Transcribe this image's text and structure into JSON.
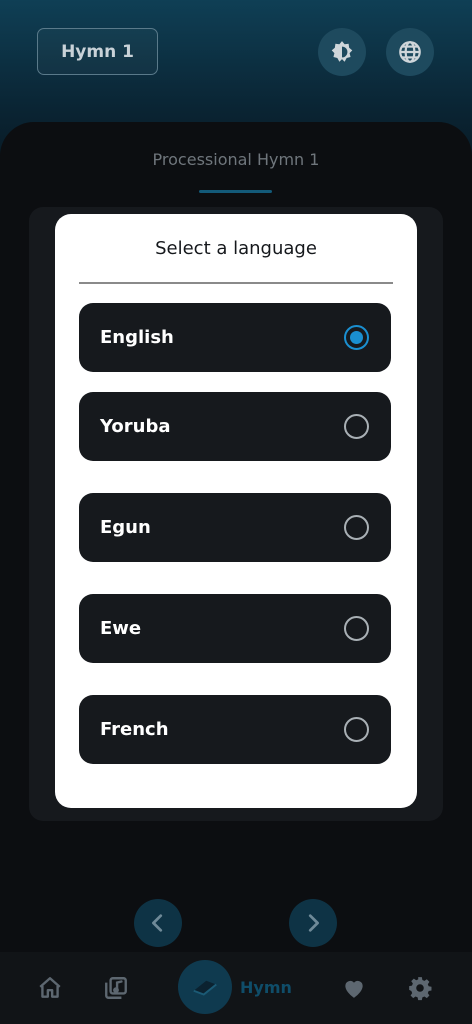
{
  "header": {
    "hymn_chip": "Hymn 1",
    "brightness_icon": "brightness-icon",
    "globe_icon": "globe-icon"
  },
  "sheet": {
    "title": "Processional Hymn 1"
  },
  "language_dialog": {
    "title": "Select a language",
    "selected": "English",
    "options": [
      {
        "label": "English"
      },
      {
        "label": "Yoruba"
      },
      {
        "label": "Egun"
      },
      {
        "label": "Ewe"
      },
      {
        "label": "French"
      }
    ]
  },
  "navigation": {
    "prev_icon": "chevron-left-icon",
    "next_icon": "chevron-right-icon"
  },
  "bottom_nav": {
    "items": [
      {
        "icon": "home-icon"
      },
      {
        "icon": "library-icon"
      },
      {
        "icon": "book-icon",
        "label": "Hymn"
      },
      {
        "icon": "heart-icon"
      },
      {
        "icon": "gear-icon"
      }
    ]
  },
  "colors": {
    "accent": "#1a8fd0",
    "header": "#0f3f55",
    "surface": "#16191d"
  }
}
